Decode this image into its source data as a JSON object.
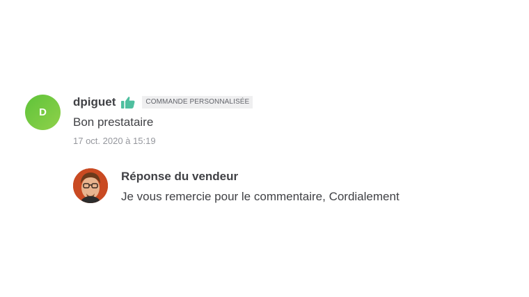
{
  "review": {
    "avatar_letter": "D",
    "avatar_color": "#6cc63f",
    "username": "dpiguet",
    "rating_icon": "thumbs-up-icon",
    "rating_icon_color": "#4fbf9f",
    "badge": "COMMANDE PERSONNALISÉE",
    "text": "Bon prestataire",
    "date": "17 oct. 2020 à 15:19"
  },
  "reply": {
    "avatar_icon": "seller-photo",
    "title": "Réponse du vendeur",
    "text": "Je vous remercie pour le commentaire, Cordialement"
  }
}
